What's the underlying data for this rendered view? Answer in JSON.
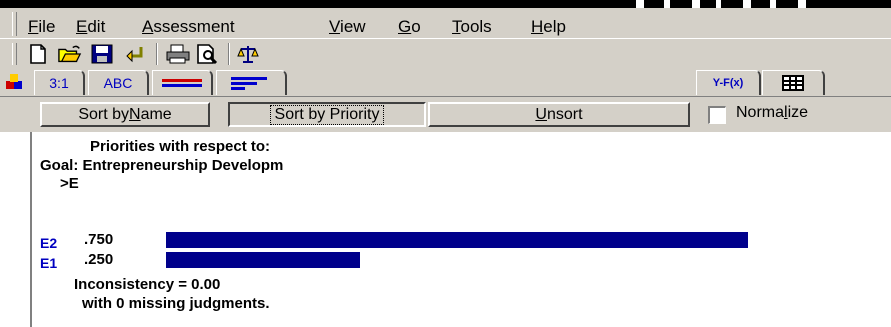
{
  "menu": {
    "items": [
      {
        "pre": "",
        "ul": "F",
        "post": "ile"
      },
      {
        "pre": "",
        "ul": "E",
        "post": "dit"
      },
      {
        "pre": "",
        "ul": "A",
        "post": "ssessment"
      },
      {
        "pre": "",
        "ul": "V",
        "post": "iew"
      },
      {
        "pre": "",
        "ul": "G",
        "post": "o"
      },
      {
        "pre": "",
        "ul": "T",
        "post": "ools"
      },
      {
        "pre": "",
        "ul": "H",
        "post": "elp"
      }
    ]
  },
  "toolbar": {
    "icons": [
      "new-file-icon",
      "open-folder-icon",
      "save-disk-icon",
      "undo-arrow-icon",
      "print-icon",
      "print-preview-icon",
      "scales-icon"
    ]
  },
  "tabs": {
    "ratio_label": "3:1",
    "abc_label": "ABC",
    "formula_label": "Y-F(x)"
  },
  "sortbar": {
    "sort_name_pre": "Sort by ",
    "sort_name_ul": "N",
    "sort_name_post": "ame",
    "sort_priority": "Sort by Priority",
    "unsort_ul": "U",
    "unsort_post": "nsort",
    "normalize_pre": "Norma",
    "normalize_ul": "l",
    "normalize_post": "ize",
    "normalize_checked": false
  },
  "content": {
    "heading": "Priorities with respect to:",
    "goal": "Goal: Entrepreneurship Developm",
    "sub": ">E",
    "rows": [
      {
        "label": "E2",
        "value": ".750",
        "priority": 0.75
      },
      {
        "label": "E1",
        "value": ".250",
        "priority": 0.25
      }
    ],
    "inconsistency": "Inconsistency = 0.00",
    "missing": "with 0  missing judgments."
  },
  "colors": {
    "bar": "#00008b",
    "label": "#0000c0",
    "chrome": "#d4d0c8"
  }
}
